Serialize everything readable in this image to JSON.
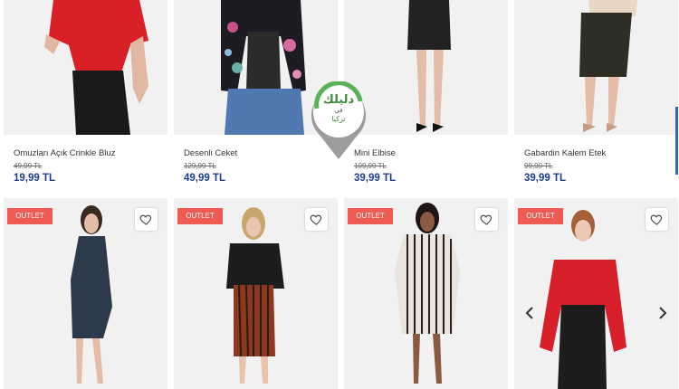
{
  "top_row": [
    {
      "name": "Omuzları Açık Crinkle Bluz",
      "old_price": "49,99 TL",
      "price": "19,99 TL"
    },
    {
      "name": "Desenli Ceket",
      "old_price": "129,99 TL",
      "price": "49,99 TL"
    },
    {
      "name": "Mini Elbise",
      "old_price": "109,99 TL",
      "price": "39,99 TL"
    },
    {
      "name": "Gabardin Kalem Etek",
      "old_price": "99,99 TL",
      "price": "39,99 TL"
    }
  ],
  "bottom_row": [
    {
      "badge": "OUTLET",
      "favorite_icon": "heart-icon"
    },
    {
      "badge": "OUTLET",
      "favorite_icon": "heart-icon"
    },
    {
      "badge": "OUTLET",
      "favorite_icon": "heart-icon"
    },
    {
      "badge": "OUTLET",
      "favorite_icon": "heart-icon"
    }
  ],
  "carousel": {
    "prev_icon": "chevron-left-icon",
    "next_icon": "chevron-right-icon"
  },
  "watermark": {
    "line1": "دليلك",
    "line2": "في",
    "line3": "تركيا"
  },
  "colors": {
    "price": "#1d3c8f",
    "badge": "#ef5a52",
    "watermark": "#3f8a3d",
    "accent_bar": "#3566b5"
  }
}
